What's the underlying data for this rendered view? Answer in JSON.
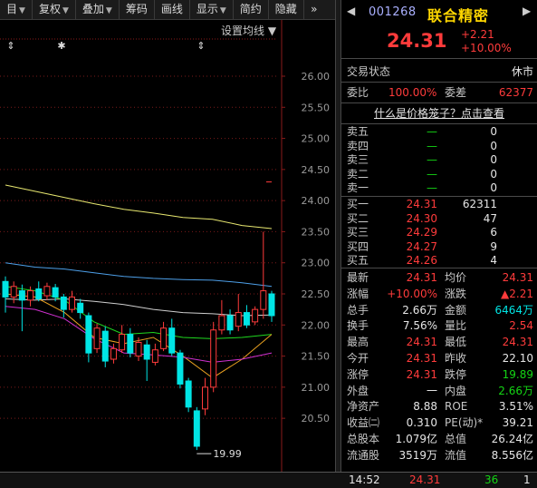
{
  "toolbar": {
    "items": [
      {
        "label": "目",
        "arrow": "▼"
      },
      {
        "label": "复权",
        "arrow": "▼"
      },
      {
        "label": "叠加",
        "arrow": "▼"
      },
      {
        "label": "筹码",
        "arrow": ""
      },
      {
        "label": "画线",
        "arrow": ""
      },
      {
        "label": "显示",
        "arrow": "▼"
      },
      {
        "label": "简约",
        "arrow": ""
      },
      {
        "label": "隐藏",
        "arrow": ""
      }
    ],
    "more": "»"
  },
  "chart_header": {
    "ma_setting": "设置均线",
    "ma_arrow": "▼"
  },
  "chart_data": {
    "type": "candlestick",
    "y_ticks": [
      "26.00",
      "25.50",
      "25.00",
      "24.50",
      "24.00",
      "23.50",
      "23.00",
      "22.50",
      "22.00",
      "21.50",
      "21.00",
      "20.50"
    ],
    "ylim": [
      20.05,
      26.35
    ],
    "low_marker": "19.99",
    "candles": [
      {
        "o": 22.7,
        "c": 22.45,
        "h": 22.78,
        "l": 22.2
      },
      {
        "o": 22.45,
        "c": 22.62,
        "h": 22.7,
        "l": 22.35
      },
      {
        "o": 22.55,
        "c": 22.4,
        "h": 22.65,
        "l": 21.9
      },
      {
        "o": 22.4,
        "c": 22.55,
        "h": 22.62,
        "l": 22.3
      },
      {
        "o": 22.58,
        "c": 22.42,
        "h": 22.7,
        "l": 22.38
      },
      {
        "o": 22.47,
        "c": 22.62,
        "h": 22.68,
        "l": 22.4
      },
      {
        "o": 22.6,
        "c": 22.45,
        "h": 22.66,
        "l": 22.38
      },
      {
        "o": 22.45,
        "c": 22.25,
        "h": 22.5,
        "l": 22.12
      },
      {
        "o": 22.25,
        "c": 22.45,
        "h": 22.55,
        "l": 22.2
      },
      {
        "o": 22.35,
        "c": 22.2,
        "h": 22.42,
        "l": 22.1
      },
      {
        "o": 22.15,
        "c": 21.55,
        "h": 22.2,
        "l": 21.4
      },
      {
        "o": 21.62,
        "c": 21.95,
        "h": 22.02,
        "l": 21.55
      },
      {
        "o": 21.9,
        "c": 21.42,
        "h": 21.98,
        "l": 21.32
      },
      {
        "o": 21.45,
        "c": 21.62,
        "h": 21.7,
        "l": 21.38
      },
      {
        "o": 21.6,
        "c": 21.85,
        "h": 22.0,
        "l": 21.55
      },
      {
        "o": 21.85,
        "c": 21.55,
        "h": 21.95,
        "l": 21.48
      },
      {
        "o": 21.5,
        "c": 21.72,
        "h": 21.8,
        "l": 21.42
      },
      {
        "o": 21.68,
        "c": 21.45,
        "h": 21.76,
        "l": 21.1
      },
      {
        "o": 21.4,
        "c": 21.6,
        "h": 21.7,
        "l": 21.35
      },
      {
        "o": 21.62,
        "c": 21.95,
        "h": 22.05,
        "l": 21.58
      },
      {
        "o": 21.95,
        "c": 21.55,
        "h": 22.1,
        "l": 21.5
      },
      {
        "o": 21.55,
        "c": 21.05,
        "h": 21.6,
        "l": 20.98
      },
      {
        "o": 21.1,
        "c": 20.68,
        "h": 21.15,
        "l": 20.6
      },
      {
        "o": 20.62,
        "c": 20.05,
        "h": 20.68,
        "l": 19.99
      },
      {
        "o": 20.65,
        "c": 21.0,
        "h": 21.15,
        "l": 20.55
      },
      {
        "o": 21.0,
        "c": 21.92,
        "h": 22.05,
        "l": 20.92
      },
      {
        "o": 21.92,
        "c": 22.15,
        "h": 22.4,
        "l": 21.85
      },
      {
        "o": 22.15,
        "c": 21.92,
        "h": 22.25,
        "l": 21.85
      },
      {
        "o": 21.98,
        "c": 22.2,
        "h": 22.5,
        "l": 21.9
      },
      {
        "o": 22.2,
        "c": 22.0,
        "h": 22.32,
        "l": 21.95
      },
      {
        "o": 22.05,
        "c": 22.25,
        "h": 22.3,
        "l": 22.0
      },
      {
        "o": 22.25,
        "c": 22.55,
        "h": 23.5,
        "l": 22.1
      },
      {
        "o": 22.5,
        "c": 22.15,
        "h": 22.55,
        "l": 22.05
      }
    ],
    "ma_series": [
      {
        "color": "#e8e870",
        "values": [
          24.25,
          24.15,
          24.05,
          23.95,
          23.86,
          23.8,
          23.73,
          23.7,
          23.6,
          23.55
        ]
      },
      {
        "color": "#4d9fe8",
        "values": [
          23.0,
          22.93,
          22.9,
          22.84,
          22.78,
          22.75,
          22.73,
          22.72,
          22.68,
          22.62
        ]
      },
      {
        "color": "#cfcfcf",
        "values": [
          22.42,
          22.4,
          22.42,
          22.38,
          22.33,
          22.25,
          22.2,
          22.18,
          22.15,
          22.16
        ]
      },
      {
        "color": "#1fd81f",
        "values": [
          22.62,
          22.55,
          22.4,
          22.05,
          21.85,
          21.88,
          21.8,
          21.78,
          21.8,
          21.85
        ]
      },
      {
        "color": "#e8a020",
        "values": [
          22.5,
          22.45,
          22.2,
          21.8,
          21.7,
          21.8,
          21.5,
          21.15,
          21.45,
          21.85
        ]
      },
      {
        "color": "#d030d0",
        "values": [
          22.3,
          22.25,
          22.1,
          21.78,
          21.55,
          21.52,
          21.48,
          21.4,
          21.45,
          21.55
        ]
      }
    ],
    "markers": {
      "up_arrow": "⇕",
      "star": "✱"
    }
  },
  "quote": {
    "code": "001268",
    "name": "联合精密",
    "price": "24.31",
    "change": "+2.21",
    "change_pct": "+10.00%",
    "status_label": "交易状态",
    "status_value": "休市",
    "webi_label": "委比",
    "webi_value": "100.00%",
    "weicha_label": "委差",
    "weicha_value": "62377",
    "link": "什么是价格笼子？点击查看"
  },
  "order_book": {
    "asks": [
      {
        "label": "卖五",
        "price": "—",
        "vol": "0"
      },
      {
        "label": "卖四",
        "price": "—",
        "vol": "0"
      },
      {
        "label": "卖三",
        "price": "—",
        "vol": "0"
      },
      {
        "label": "卖二",
        "price": "—",
        "vol": "0"
      },
      {
        "label": "卖一",
        "price": "—",
        "vol": "0"
      }
    ],
    "bids": [
      {
        "label": "买一",
        "price": "24.31",
        "vol": "62311"
      },
      {
        "label": "买二",
        "price": "24.30",
        "vol": "47"
      },
      {
        "label": "买三",
        "price": "24.29",
        "vol": "6"
      },
      {
        "label": "买四",
        "price": "24.27",
        "vol": "9"
      },
      {
        "label": "买五",
        "price": "24.26",
        "vol": "4"
      }
    ]
  },
  "stats": [
    [
      {
        "l": "最新",
        "v": "24.31",
        "c": "red"
      },
      {
        "l": "均价",
        "v": "24.31",
        "c": "red"
      }
    ],
    [
      {
        "l": "涨幅",
        "v": "+10.00%",
        "c": "red"
      },
      {
        "l": "涨跌",
        "v": "▲2.21",
        "c": "red"
      }
    ],
    [
      {
        "l": "总手",
        "v": "2.66万",
        "c": "white"
      },
      {
        "l": "金额",
        "v": "6464万",
        "c": "cyan"
      }
    ],
    [
      {
        "l": "换手",
        "v": "7.56%",
        "c": "white"
      },
      {
        "l": "量比",
        "v": "2.54",
        "c": "red"
      }
    ],
    [
      {
        "l": "最高",
        "v": "24.31",
        "c": "red"
      },
      {
        "l": "最低",
        "v": "24.31",
        "c": "red"
      }
    ],
    [
      {
        "l": "今开",
        "v": "24.31",
        "c": "red"
      },
      {
        "l": "昨收",
        "v": "22.10",
        "c": "white"
      }
    ],
    [
      {
        "l": "涨停",
        "v": "24.31",
        "c": "red"
      },
      {
        "l": "跌停",
        "v": "19.89",
        "c": "green"
      }
    ],
    [
      {
        "l": "外盘",
        "v": "一",
        "c": "white"
      },
      {
        "l": "内盘",
        "v": "2.66万",
        "c": "green"
      }
    ],
    [
      {
        "l": "净资产",
        "v": "8.88",
        "c": "white"
      },
      {
        "l": "ROE",
        "v": "3.51%",
        "c": "white"
      }
    ],
    [
      {
        "l": "收益㈡",
        "v": "0.310",
        "c": "white"
      },
      {
        "l": "PE(动)*",
        "v": "39.21",
        "c": "white"
      }
    ],
    [
      {
        "l": "总股本",
        "v": "1.079亿",
        "c": "white"
      },
      {
        "l": "总值",
        "v": "26.24亿",
        "c": "white"
      }
    ],
    [
      {
        "l": "流通股",
        "v": "3519万",
        "c": "white"
      },
      {
        "l": "流值",
        "v": "8.556亿",
        "c": "white"
      }
    ]
  ],
  "footer": {
    "time": "14:52",
    "price": "24.31",
    "vol": "36",
    "count": "1"
  }
}
